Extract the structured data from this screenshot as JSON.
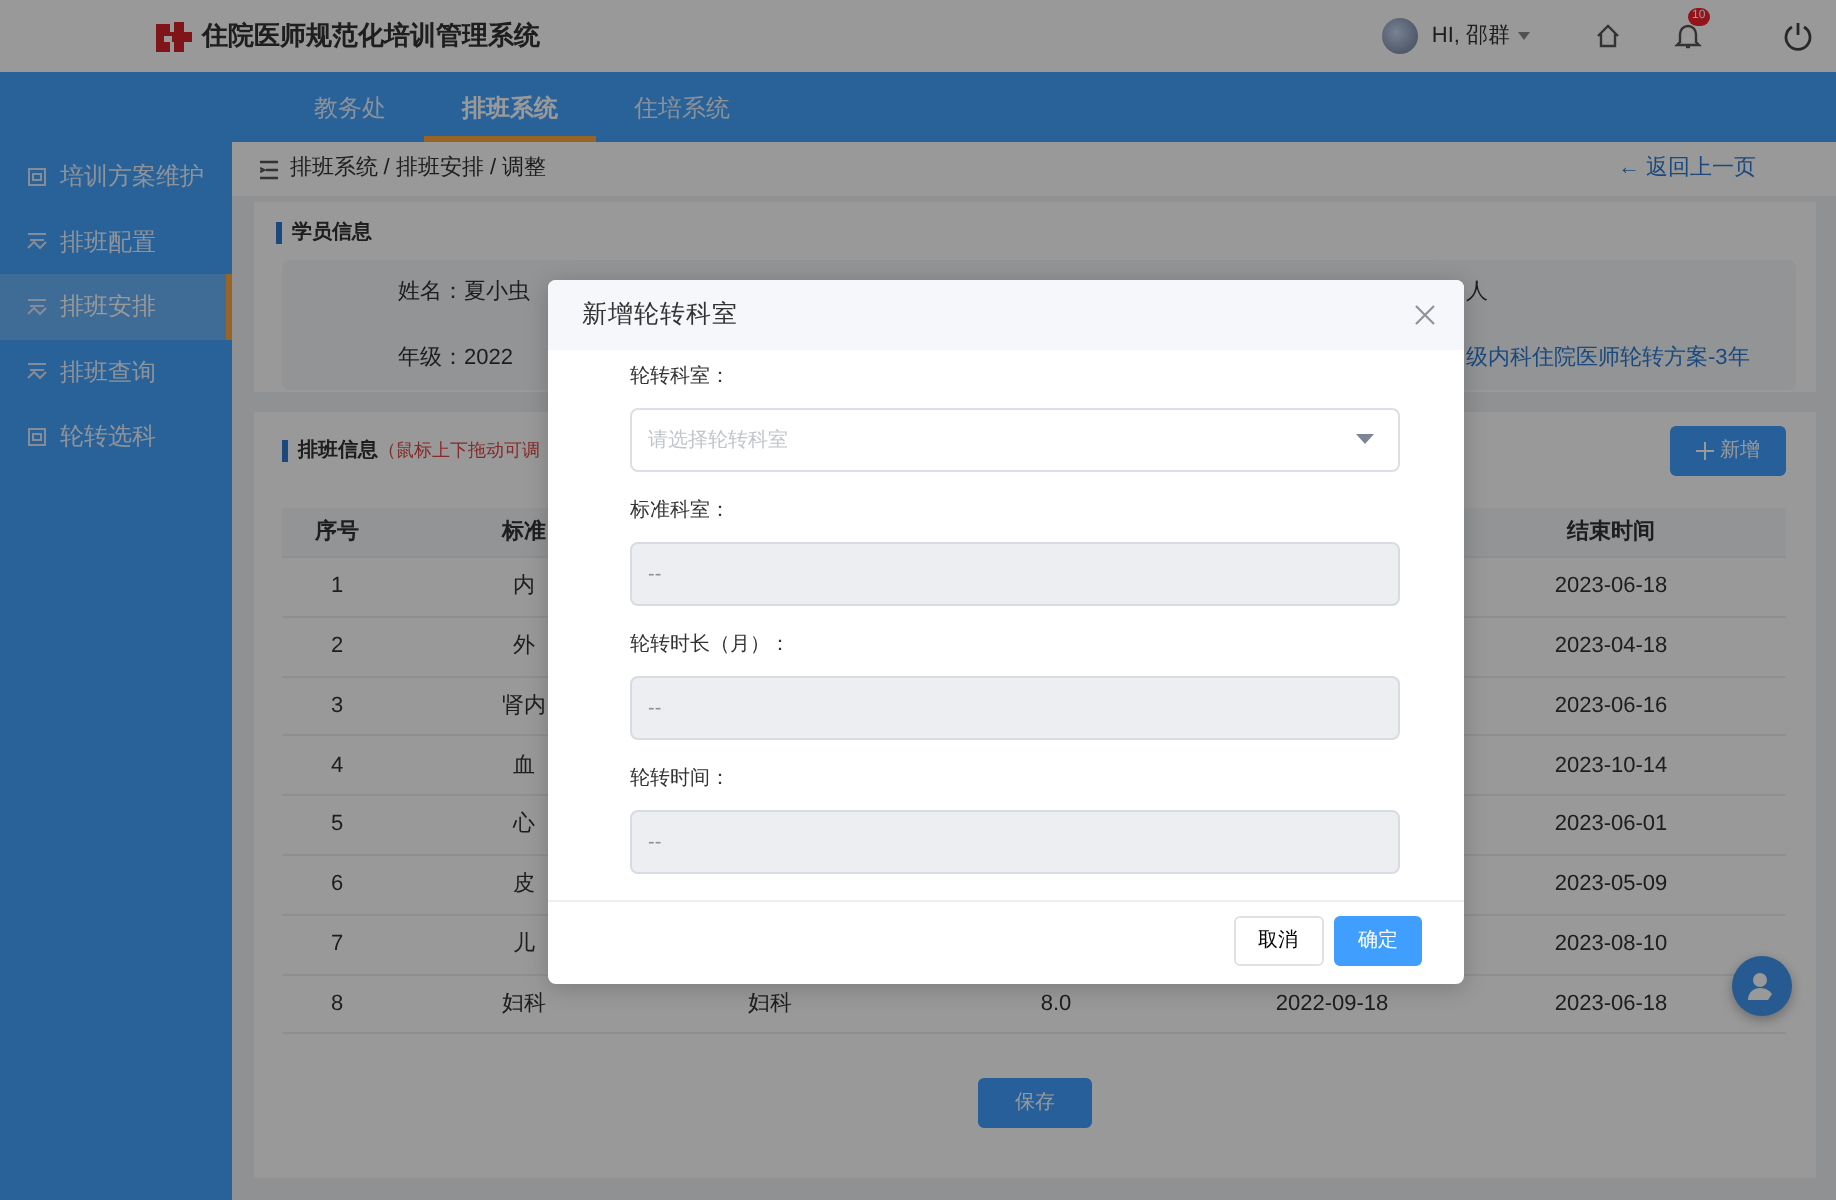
{
  "header": {
    "title": "住院医师规范化培训管理系统",
    "user": "HI, 邵群",
    "notification_count": "10"
  },
  "top_nav": [
    {
      "label": "教务处",
      "selected": false
    },
    {
      "label": "排班系统",
      "selected": true
    },
    {
      "label": "住培系统",
      "selected": false
    }
  ],
  "sidebar": {
    "items": [
      {
        "label": "培训方案维护",
        "selected": false
      },
      {
        "label": "排班配置",
        "selected": false
      },
      {
        "label": "排班安排",
        "selected": true
      },
      {
        "label": "排班查询",
        "selected": false
      },
      {
        "label": "轮转选科",
        "selected": false
      }
    ]
  },
  "breadcrumb": "排班系统 / 排班安排 / 调整",
  "back_link": "← 返回上一页",
  "student_info": {
    "title": "学员信息",
    "fields": [
      "姓名：夏小虫",
      "年级：2022"
    ],
    "right_fields": [
      {
        "text": "人",
        "kind": "text"
      },
      {
        "text": "级内科住院医师轮转方案-3年",
        "kind": "link"
      }
    ]
  },
  "schedule": {
    "title": "排班信息",
    "hint": "（鼠标上下拖动可调",
    "add_button": "新增",
    "header": {
      "column_1": "序号",
      "column_2": "标准",
      "column_6": "结束时间"
    },
    "rows": [
      {
        "column_1": "1",
        "column_2": "内",
        "column_6": "2023-06-18"
      },
      {
        "column_1": "2",
        "column_2": "外",
        "column_6": "2023-04-18"
      },
      {
        "column_1": "3",
        "column_2": "肾内",
        "column_6": "2023-06-16"
      },
      {
        "column_1": "4",
        "column_2": "血",
        "column_6": "2023-10-14"
      },
      {
        "column_1": "5",
        "column_2": "心",
        "column_6": "2023-06-01"
      },
      {
        "column_1": "6",
        "column_2": "皮",
        "column_6": "2023-05-09"
      },
      {
        "column_1": "7",
        "column_2": "儿",
        "column_6": "2023-08-10"
      },
      {
        "column_1": "8",
        "column_2": "妇科",
        "column_3": "妇科",
        "column_4": "8.0",
        "column_5": "2022-09-18",
        "column_6": "2023-06-18"
      }
    ],
    "save_button": "保存"
  },
  "modal": {
    "title": "新增轮转科室",
    "fields": [
      {
        "label": "轮转科室：",
        "kind": "select",
        "placeholder": "请选择轮转科室",
        "disabled": false
      },
      {
        "label": "标准科室：",
        "kind": "text",
        "placeholder": "--",
        "disabled": true
      },
      {
        "label": "轮转时长（月）：",
        "kind": "text",
        "placeholder": "--",
        "disabled": true
      },
      {
        "label": "轮转时间：",
        "kind": "text",
        "placeholder": "--",
        "disabled": true
      }
    ],
    "buttons": [
      {
        "label": "取消",
        "kind": "default"
      },
      {
        "label": "确定",
        "kind": "primary"
      }
    ]
  }
}
